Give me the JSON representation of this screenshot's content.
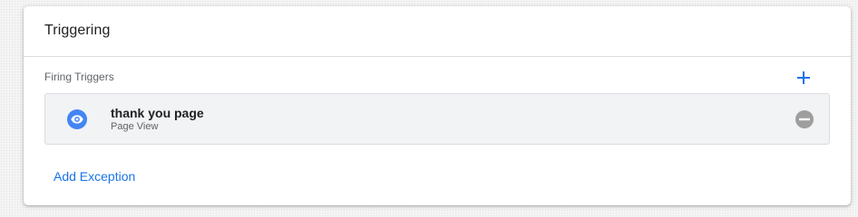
{
  "card": {
    "title": "Triggering"
  },
  "firing_triggers": {
    "section_label": "Firing Triggers",
    "add_icon": "plus-icon",
    "items": [
      {
        "name": "thank you page",
        "type": "Page View",
        "icon": "eye-icon",
        "icon_color": "#4285f4",
        "remove_icon": "minus-circle-icon"
      }
    ]
  },
  "exceptions": {
    "add_label": "Add Exception"
  },
  "colors": {
    "accent": "#1a73e8",
    "trigger_icon": "#4285f4",
    "remove_icon": "#9e9e9e"
  }
}
